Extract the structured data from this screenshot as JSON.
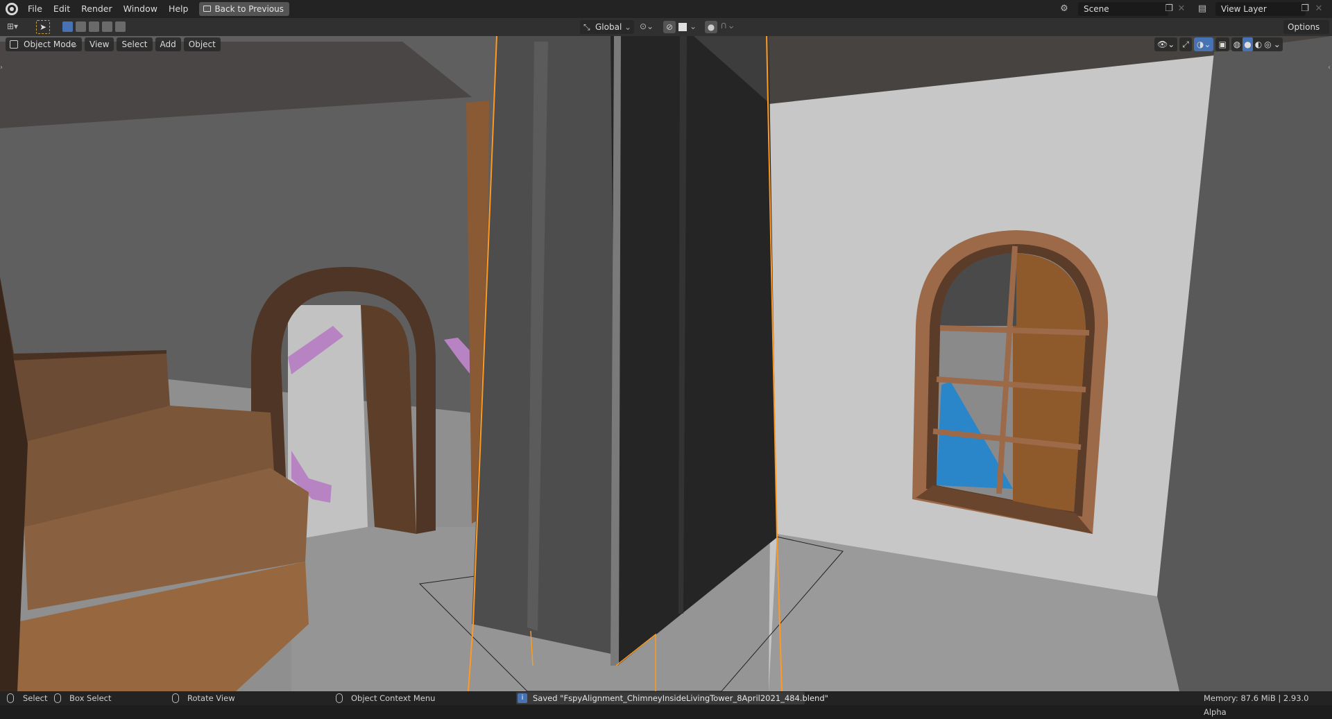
{
  "menu": {
    "file": "File",
    "edit": "Edit",
    "render": "Render",
    "window": "Window",
    "help": "Help",
    "back_button": "Back to Previous"
  },
  "header_right": {
    "scene": "Scene",
    "view_layer": "View Layer"
  },
  "toolbar": {
    "transform_orientation": "Global",
    "options": "Options"
  },
  "viewport_header": {
    "mode": "Object Mode",
    "view": "View",
    "select": "Select",
    "add": "Add",
    "object": "Object"
  },
  "status": {
    "select": "Select",
    "box_select": "Box Select",
    "rotate_view": "Rotate View",
    "context_menu": "Object Context Menu",
    "saved_message": "Saved \"FspyAlignment_ChimneyInsideLivingTower_8April2021_484.blend\"",
    "memory": "Memory: 87.6 MiB | 2.93.0 Alpha"
  },
  "colors": {
    "selection_outline": "#ff9a1f",
    "accent_blue": "#4772b3",
    "bg": "#1d1d1d"
  }
}
